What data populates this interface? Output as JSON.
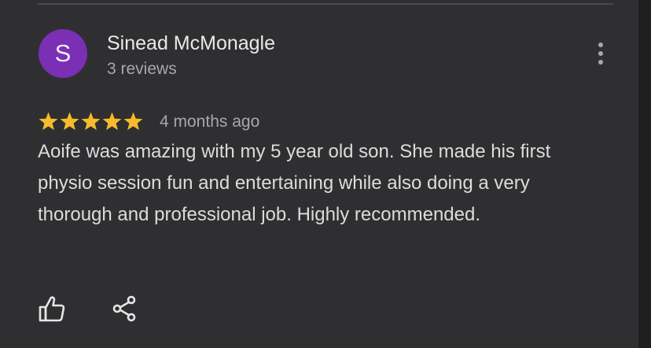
{
  "review": {
    "avatar_initial": "S",
    "reviewer_name": "Sinead McMonagle",
    "review_count": "3 reviews",
    "rating": 5,
    "rating_max": 5,
    "date": "4 months ago",
    "text": "Aoife was amazing with my 5 year old son. She made his first physio session fun and entertaining while also doing a very thorough and professional job. Highly recommended."
  },
  "icons": {
    "more": "more-vert-icon",
    "like": "thumbs-up-icon",
    "share": "share-icon",
    "star": "star-icon"
  },
  "colors": {
    "background": "#2f2f31",
    "avatar": "#7b2fb4",
    "star": "#f6bb2a",
    "primary_text": "#e9e9e9",
    "secondary_text": "#a8a8ab"
  }
}
